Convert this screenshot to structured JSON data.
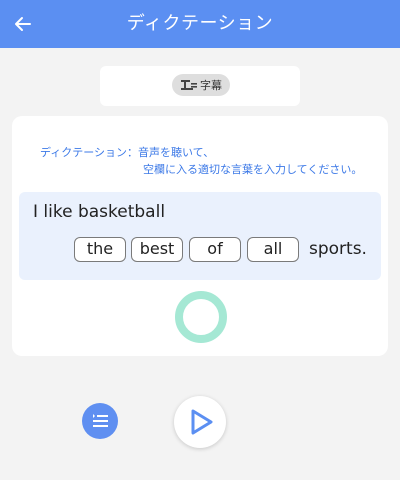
{
  "header": {
    "title": "ディクテーション",
    "back_icon": "arrow-left-icon"
  },
  "subtitle_toggle": {
    "label": "字幕",
    "icon": "subtitle-icon"
  },
  "instruction": {
    "label": "ディクテーション：",
    "line1": "音声を聴いて、",
    "line2": "空欄に入る適切な言葉を入力してください。"
  },
  "sentence": {
    "start": "I like basketball",
    "blanks": [
      "the",
      "best",
      "of",
      "all"
    ],
    "end": "sports."
  },
  "controls": {
    "list_icon": "list-icon",
    "play_icon": "play-icon"
  },
  "colors": {
    "accent": "#5b8ff2",
    "instruction_text": "#3c79e7",
    "highlight_bg": "#eaf1fd",
    "ring": "#a5e8d4"
  }
}
